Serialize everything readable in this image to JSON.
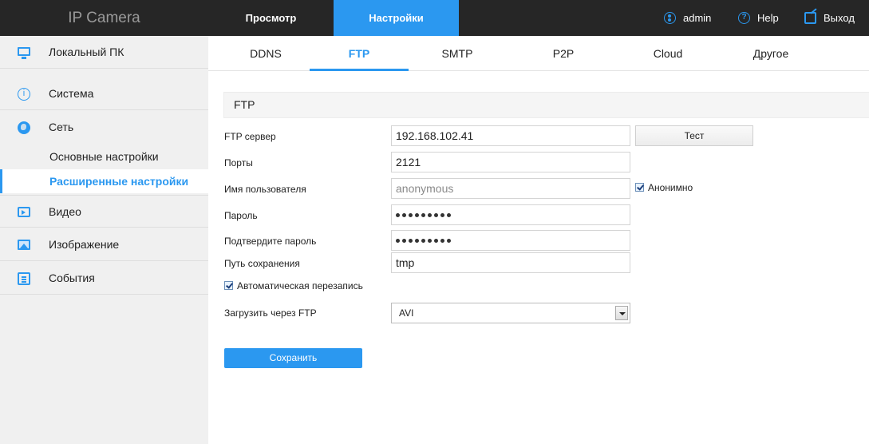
{
  "header": {
    "brand": "IP Camera",
    "tabs": [
      {
        "label": "Просмотр",
        "active": false
      },
      {
        "label": "Настройки",
        "active": true
      }
    ],
    "user": "admin",
    "help": "Help",
    "logout": "Выход",
    "accent_color": "#2b98f0",
    "bar_color": "#262626"
  },
  "sidebar": {
    "items": [
      {
        "label": "Локальный ПК",
        "icon": "monitor-icon"
      },
      {
        "label": "Система",
        "icon": "info-icon"
      },
      {
        "label": "Сеть",
        "icon": "globe-icon"
      },
      {
        "label": "Видео",
        "icon": "video-icon"
      },
      {
        "label": "Изображение",
        "icon": "image-icon"
      },
      {
        "label": "События",
        "icon": "events-icon"
      }
    ],
    "subitems": [
      {
        "label": "Основные настройки",
        "active": false
      },
      {
        "label": "Расширенные настройки",
        "active": true
      }
    ]
  },
  "subtabs": [
    {
      "label": "DDNS",
      "active": false
    },
    {
      "label": "FTP",
      "active": true
    },
    {
      "label": "SMTP",
      "active": false
    },
    {
      "label": "P2P",
      "active": false
    },
    {
      "label": "Cloud",
      "active": false
    },
    {
      "label": "Другое",
      "active": false
    }
  ],
  "form": {
    "section_title": "FTP",
    "server_label": "FTP сервер",
    "server_value": "192.168.102.41",
    "test_button": "Тест",
    "port_label": "Порты",
    "port_value": "2121",
    "user_label": "Имя пользователя",
    "user_value": "anonymous",
    "anonymous_label": "Анонимно",
    "anonymous_checked": true,
    "password_label": "Пароль",
    "confirm_label": "Подтвердите пароль",
    "path_label": "Путь сохранения",
    "path_value": "tmp",
    "overwrite_label": "Автоматическая перезапись",
    "overwrite_checked": true,
    "upload_label": "Загрузить через FTP",
    "upload_value": "AVI",
    "save_button": "Сохранить"
  }
}
